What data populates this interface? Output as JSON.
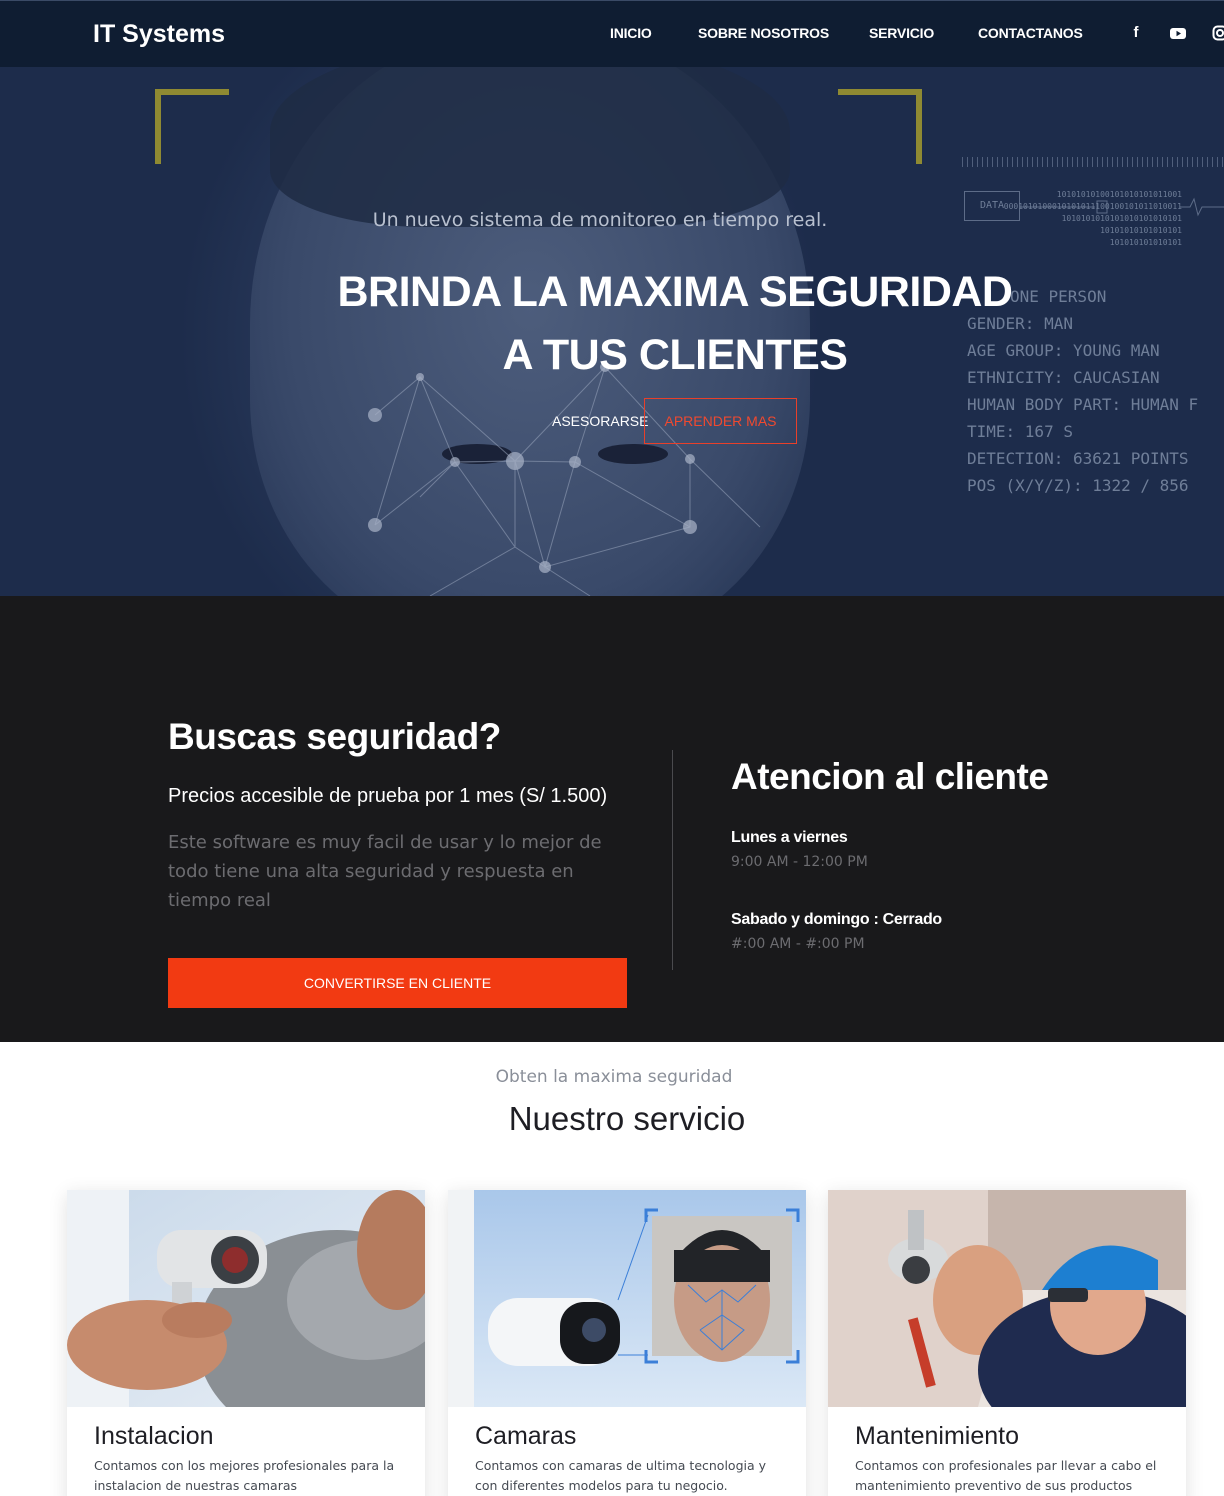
{
  "nav": {
    "brand": "IT Systems",
    "links": [
      "INICIO",
      "SOBRE NOSOTROS",
      "SERVICIO",
      "CONTACTANOS"
    ],
    "social_icons": [
      "facebook-icon",
      "youtube-icon",
      "instagram-icon"
    ]
  },
  "hero": {
    "subtitle": "Un nuevo sistema de monitoreo en tiempo real.",
    "title_line1": "BRINDA LA MAXIMA SEGURIDAD",
    "title_line2": "A TUS CLIENTES",
    "btn_primary": "ASESORARSE",
    "btn_secondary": "APRENDER MAS",
    "overlay": {
      "data_label": "DATA",
      "lines": [
        "ONE PERSON",
        "GENDER: MAN",
        "AGE GROUP: YOUNG MAN",
        "ETHNICITY: CAUCASIAN",
        "HUMAN BODY PART: HUMAN F",
        "TIME: 167 S",
        "DETECTION: 63621 POINTS",
        "POS (X/Y/Z): 1322 / 856"
      ],
      "binary": [
        "10101010100101010101011001",
        "0001010100010101011100100101011010011",
        "1010101010101010101010101",
        "10101010101010101",
        "101010101010101"
      ]
    }
  },
  "promo": {
    "heading": "Buscas seguridad?",
    "price_line": "Precios accesible de prueba por 1 mes (S/ 1.500)",
    "description": "Este software es muy facil de usar y lo mejor de todo tiene una alta seguridad y respuesta en tiempo real",
    "cta": "CONVERTIRSE EN CLIENTE"
  },
  "support": {
    "heading": "Atencion al cliente",
    "weekday_label": "Lunes a viernes",
    "weekday_hours": "9:00 AM - 12:00 PM",
    "weekend_label": "Sabado y domingo : Cerrado",
    "weekend_hours": "#:00 AM - #:00 PM"
  },
  "services": {
    "subtitle": "Obten la maxima seguridad",
    "title": "Nuestro servicio",
    "cards": [
      {
        "title": "Instalacion",
        "text": "Contamos con los mejores profesionales para la instalacion de nuestras camaras"
      },
      {
        "title": "Camaras",
        "text": "Contamos con camaras de ultima tecnologia y con diferentes modelos para tu negocio."
      },
      {
        "title": "Mantenimiento",
        "text": "Contamos con profesionales par llevar a cabo el mantenimiento preventivo de sus productos"
      }
    ]
  }
}
